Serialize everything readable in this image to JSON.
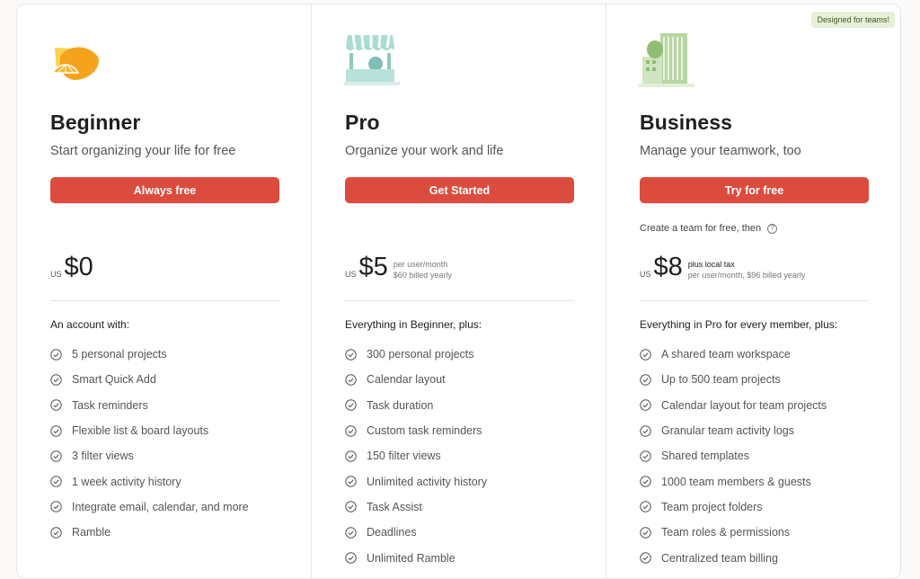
{
  "plans": [
    {
      "illustration": "orange-slice-icon",
      "title": "Beginner",
      "subtitle": "Start organizing your life for free",
      "cta": "Always free",
      "currency": "US",
      "amount": "$0",
      "features_heading": "An account with:",
      "features": [
        "5 personal projects",
        "Smart Quick Add",
        "Task reminders",
        "Flexible list & board layouts",
        "3 filter views",
        "1 week activity history",
        "Integrate email, calendar, and more",
        "Ramble"
      ]
    },
    {
      "illustration": "market-stall-icon",
      "title": "Pro",
      "subtitle": "Organize your work and life",
      "cta": "Get Started",
      "currency": "US",
      "amount": "$5",
      "price_note_1": "per user/month",
      "price_note_2": "$60 billed yearly",
      "features_heading": "Everything in Beginner, plus:",
      "features": [
        "300 personal projects",
        "Calendar layout",
        "Task duration",
        "Custom task reminders",
        "150 filter views",
        "Unlimited activity history",
        "Task Assist",
        "Deadlines",
        "Unlimited Ramble"
      ]
    },
    {
      "illustration": "office-building-icon",
      "badge": "Designed for teams!",
      "title": "Business",
      "subtitle": "Manage your teamwork, too",
      "cta": "Try for free",
      "team_note": "Create a team for free, then",
      "currency": "US",
      "amount": "$8",
      "price_note_1": "plus local tax",
      "price_note_2": "per user/month, $96 billed yearly",
      "features_heading": "Everything in Pro for every member, plus:",
      "features": [
        "A shared team workspace",
        "Up to 500 team projects",
        "Calendar layout for team projects",
        "Granular team activity logs",
        "Shared templates",
        "1000 team members & guests",
        "Team project folders",
        "Team roles & permissions",
        "Centralized team billing"
      ]
    }
  ],
  "colors": {
    "accent": "#dc4c3e",
    "badge_bg": "#e7efd9",
    "badge_text": "#3d5a1e"
  }
}
